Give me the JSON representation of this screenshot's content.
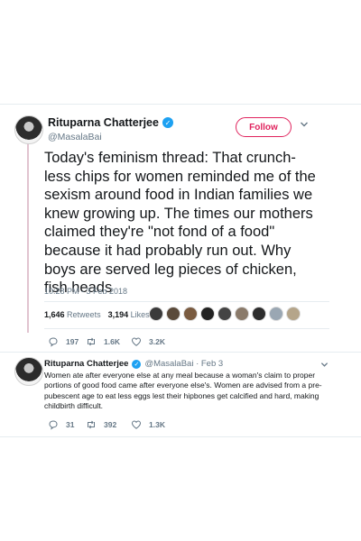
{
  "tweet": {
    "display_name": "Rituparna Chatterjee",
    "handle": "@MasalaBai",
    "follow_label": "Follow",
    "text": "Today's feminism thread: That crunch-less chips for women reminded me of the sexism around food in Indian families we knew growing up. The times our mothers claimed they're \"not fond of a food\" because it had probably run out. Why boys are served leg pieces of chicken, fish heads",
    "timestamp": "10:28 PM - 3 Feb 2018",
    "retweets_count": "1,646",
    "retweets_label": "Retweets",
    "likes_count": "3,194",
    "likes_label": "Likes",
    "replies": "197",
    "retweets_short": "1.6K",
    "likes_short": "3.2K"
  },
  "reply": {
    "display_name": "Rituparna Chatterjee",
    "handle_date": "@MasalaBai · Feb 3",
    "text": "Women ate after everyone else at any meal because a woman's claim to proper portions of good food came after everyone else's. Women are advised from a pre-pubescent age to eat less eggs lest their hipbones get calcified and hard, making childbirth difficult.",
    "replies": "31",
    "retweets": "392",
    "likes": "1.3K"
  },
  "colors": {
    "accent": "#e0245e",
    "verified": "#1da1f2",
    "muted": "#657786"
  }
}
